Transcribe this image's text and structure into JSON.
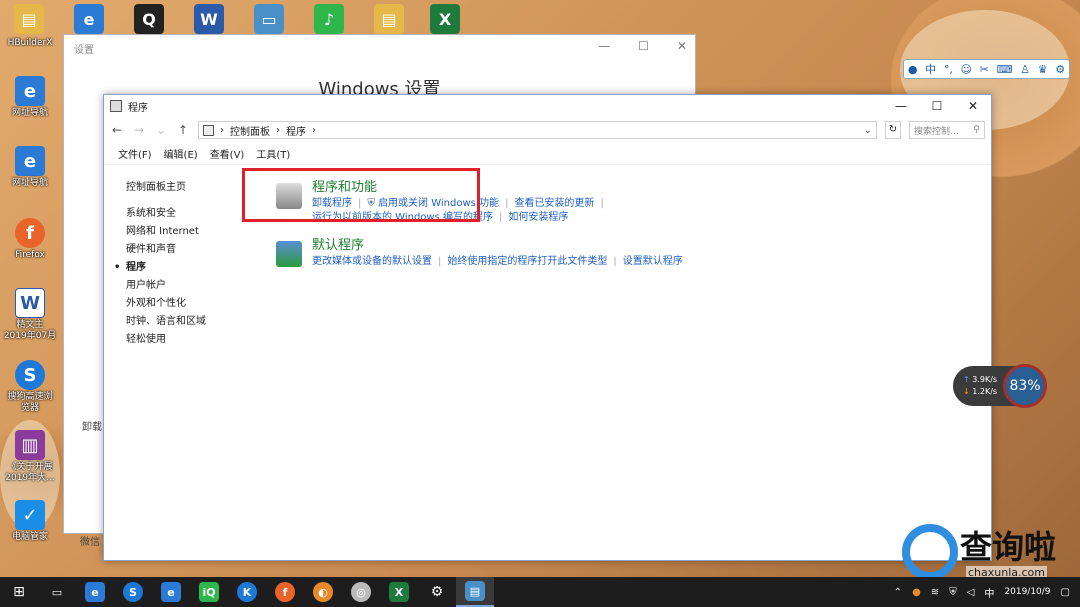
{
  "desktop": {
    "icons": [
      {
        "label": "HBuilderX",
        "icon": "folder-icon",
        "color": "#e6b84a"
      },
      {
        "label": "网址导航",
        "icon": "ie-icon",
        "color": "#2b7ad6"
      },
      {
        "label": "网址导航",
        "icon": "ie-icon",
        "color": "#2b7ad6"
      },
      {
        "label": "Firefox",
        "icon": "firefox-icon",
        "color": "#e8642a"
      },
      {
        "label": "精文主\n2019年07月",
        "icon": "word-doc-icon",
        "color": "#2b5aa8"
      },
      {
        "label": "搜狗高速浏\n览器",
        "icon": "sogou-icon",
        "color": "#1d78d8"
      },
      {
        "label": "《关于开展\n2019年大...",
        "icon": "winrar-icon",
        "color": "#8a3b9b"
      },
      {
        "label": "电脑管家",
        "icon": "shield-icon",
        "color": "#1a8ee6"
      }
    ]
  },
  "settings_window": {
    "title": "设置",
    "heading": "Windows 设置",
    "side_fragment": "卸载",
    "bottom_fragment": "微信"
  },
  "control_panel": {
    "title": "程序",
    "address": {
      "crumbs": [
        "控制面板",
        "程序"
      ],
      "search_placeholder": "搜索控制..."
    },
    "menu": [
      "文件(F)",
      "编辑(E)",
      "查看(V)",
      "工具(T)"
    ],
    "sidebar": [
      {
        "label": "控制面板主页"
      },
      {
        "label": "系统和安全"
      },
      {
        "label": "网络和 Internet"
      },
      {
        "label": "硬件和声音"
      },
      {
        "label": "程序",
        "active": true
      },
      {
        "label": "用户帐户"
      },
      {
        "label": "外观和个性化"
      },
      {
        "label": "时钟、语言和区域"
      },
      {
        "label": "轻松使用"
      }
    ],
    "categories": [
      {
        "title": "程序和功能",
        "links_row1": [
          "卸载程序",
          "启用或关闭 Windows 功能",
          "查看已安装的更新"
        ],
        "links_row2": [
          "运行为以前版本的 Windows 编写的程序",
          "如何安装程序"
        ]
      },
      {
        "title": "默认程序",
        "links_row1": [
          "更改媒体或设备的默认设置",
          "始终使用指定的程序打开此文件类型",
          "设置默认程序"
        ]
      }
    ]
  },
  "ime_bar": {
    "mode": "中"
  },
  "net_widget": {
    "up": "3.9K/s",
    "down": "1.2K/s",
    "percent": "83%"
  },
  "watermark": {
    "text": "查询啦",
    "url": "chaxunla.com"
  },
  "taskbar": {
    "ime": "中",
    "date": "2019/10/9"
  }
}
